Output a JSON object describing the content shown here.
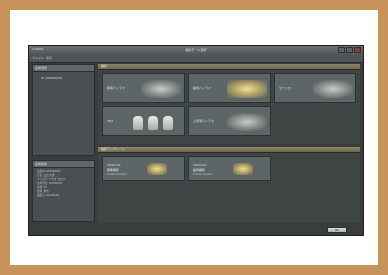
{
  "window": {
    "app_title": "ALTERA",
    "center_title": "撮影モード選択"
  },
  "menu": {
    "items": [
      "ファイル",
      "表示"
    ]
  },
  "left": {
    "patient_header": "患者選択",
    "patient_line": "ID: 0000000001",
    "info_header": "患者情報",
    "info_rows": [
      "患者ID: 0000000001",
      "氏名: 山田 太郎",
      "フリガナ: ヤマダ タロウ",
      "生年月日: 1970/01/01",
      "年齢: 54",
      "性別: 男性",
      "撮影日: 2024/01/01"
    ]
  },
  "sections": {
    "top_header": "撮影",
    "bottom_header": "撮影テンプレート"
  },
  "tiles": [
    {
      "label": "標準パノラマ"
    },
    {
      "label": "歯列パノラマ"
    },
    {
      "label": "セファロ"
    },
    {
      "label": "TMJ"
    },
    {
      "label": "上顎洞パノラマ"
    }
  ],
  "templates": [
    {
      "t1": "TEMPLATE",
      "t2": "標準撮影",
      "t3": "Pediatric Standard"
    },
    {
      "t1": "TEMPLATE",
      "t2": "歯列撮影",
      "t3": "Pediatric Standard"
    }
  ],
  "ok_label": "OK"
}
